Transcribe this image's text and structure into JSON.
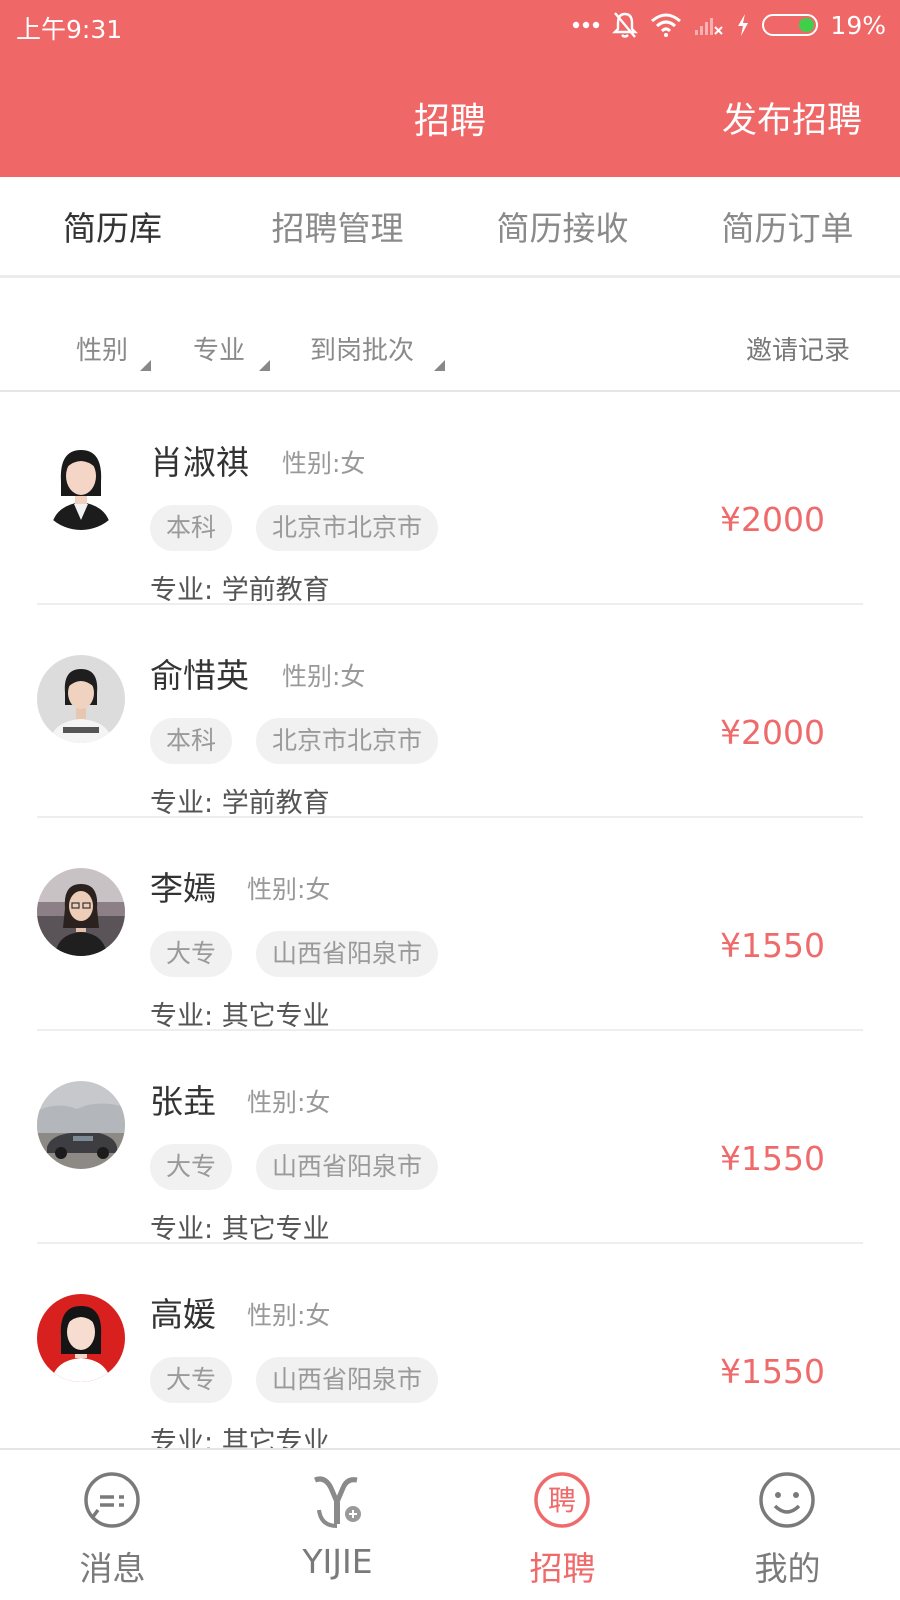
{
  "status_bar": {
    "time": "上午9:31",
    "battery_percent": "19%",
    "battery_level": 0.19,
    "icons": [
      "more-dots-icon",
      "mute-bell-icon",
      "wifi-icon",
      "no-signal-icon",
      "charging-icon",
      "battery-icon"
    ]
  },
  "header": {
    "title": "招聘",
    "publish_label": "发布招聘",
    "bg_color": "#f06767"
  },
  "tabs": [
    {
      "label": "简历库",
      "active": true
    },
    {
      "label": "招聘管理",
      "active": false
    },
    {
      "label": "简历接收",
      "active": false
    },
    {
      "label": "简历订单",
      "active": false
    }
  ],
  "filters": {
    "gender_label": "性别",
    "major_label": "专业",
    "batch_label": "到岗批次",
    "invite_label": "邀请记录"
  },
  "major_prefix": "专业: ",
  "candidates": [
    {
      "name": "肖淑祺",
      "gender": "性别:女",
      "education": "本科",
      "location": "北京市北京市",
      "major": "学前教育",
      "salary": "¥2000"
    },
    {
      "name": "俞惜英",
      "gender": "性别:女",
      "education": "本科",
      "location": "北京市北京市",
      "major": "学前教育",
      "salary": "¥2000"
    },
    {
      "name": "李嫣",
      "gender": "性别:女",
      "education": "大专",
      "location": "山西省阳泉市",
      "major": "其它专业",
      "salary": "¥1550"
    },
    {
      "name": "张垚",
      "gender": "性别:女",
      "education": "大专",
      "location": "山西省阳泉市",
      "major": "其它专业",
      "salary": "¥1550"
    },
    {
      "name": "高媛",
      "gender": "性别:女",
      "education": "大专",
      "location": "山西省阳泉市",
      "major": "其它专业",
      "salary": "¥1550"
    }
  ],
  "bottom_nav": [
    {
      "label": "消息",
      "icon": "message-icon",
      "active": false
    },
    {
      "label": "YIJIE",
      "icon": "yijie-logo-icon",
      "active": false
    },
    {
      "label": "招聘",
      "icon": "recruit-icon",
      "active": true,
      "icon_text": "聘"
    },
    {
      "label": "我的",
      "icon": "smiley-icon",
      "active": false
    }
  ],
  "colors": {
    "accent": "#f06767",
    "salary": "#ef6a6a",
    "chip_bg": "#f1f1f1"
  }
}
